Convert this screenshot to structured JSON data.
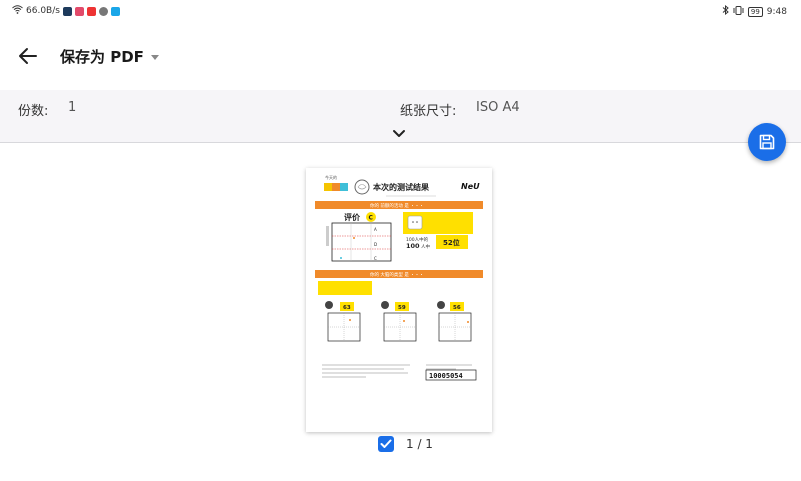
{
  "status_bar": {
    "network_speed": "66.0B/s",
    "battery": "99",
    "time": "9:48"
  },
  "toolbar": {
    "title": "保存为 PDF"
  },
  "options": {
    "copies_label": "份数:",
    "copies_value": "1",
    "paper_label": "纸张尺寸:",
    "paper_value": "ISO A4"
  },
  "preview": {
    "page_counter": "1 / 1",
    "page_selected": true,
    "doc": {
      "header_small": "今天的",
      "header_title": "本次的测试结果",
      "brand": "NeU",
      "section1": "你的 前额的活动 是 ・・・",
      "eval_label": "评价",
      "eval_grade": "C",
      "rank_prefix": "100人中的",
      "rank_number": "100",
      "rank_unit": "人中",
      "rank_value": "52位",
      "section2": "你的 大脑的类型 是 ・・・",
      "score_a": "63",
      "score_b": "59",
      "score_c": "56",
      "id_number": "10005054"
    }
  },
  "colors": {
    "accent": "#1a6ee8",
    "orange": "#f08a2a",
    "yellow": "#ffe000"
  }
}
